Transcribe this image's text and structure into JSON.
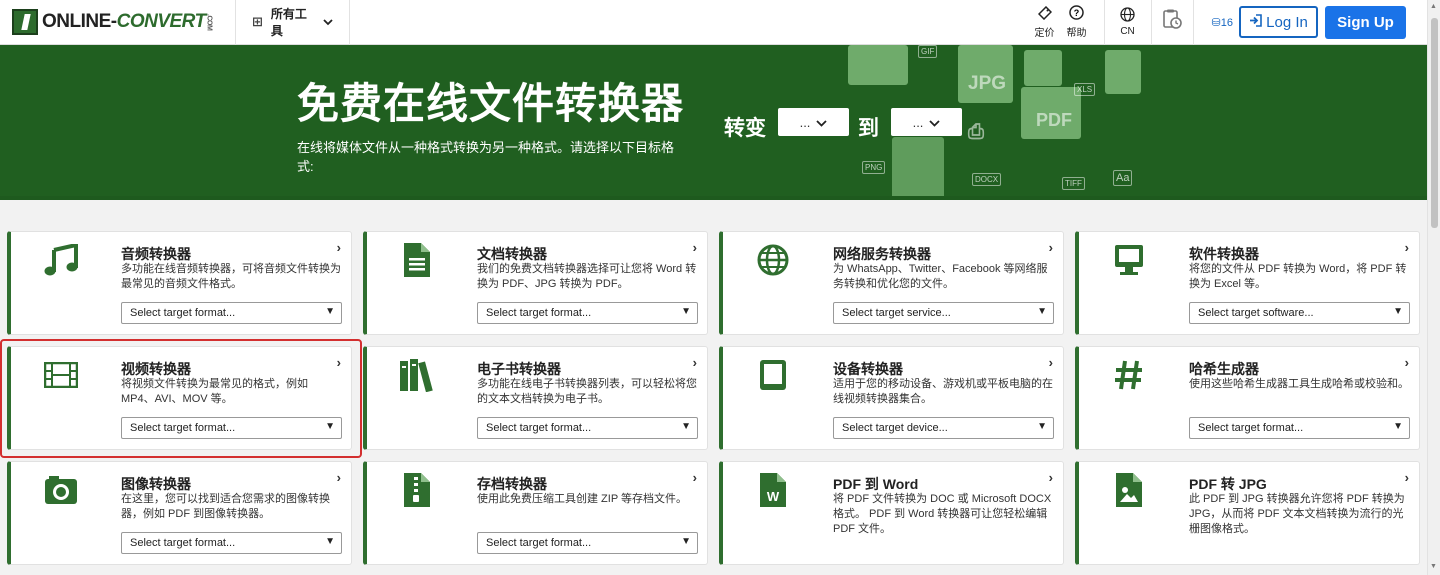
{
  "header": {
    "logo_main": "ONLINE-",
    "logo_conv": "CONVERT",
    "logo_com": ".COM",
    "all_tools": "所有工具",
    "pricing": "定价",
    "help": "帮助",
    "lang": "CN",
    "credits": "⛁16",
    "login": "Log In",
    "signup": "Sign Up"
  },
  "hero": {
    "title": "免费在线文件转换器",
    "subtitle": "在线将媒体文件从一种格式转换为另一种格式。请选择以下目标格式:",
    "convert_label": "转变",
    "to_label": "到",
    "from_select": "...",
    "to_select": "...",
    "deco_tags": [
      "GIF",
      "JPG",
      "XLS",
      "PDF",
      "PNG",
      "DOCX",
      "TIFF",
      "Aa"
    ]
  },
  "cards": [
    {
      "title": "音频转换器",
      "desc": "多功能在线音频转换器，可将音频文件转换为最常见的音频文件格式。",
      "select": "Select target format..."
    },
    {
      "title": "文档转换器",
      "desc": "我们的免费文档转换器选择可让您将 Word 转换为 PDF、JPG 转换为 PDF。",
      "select": "Select target format..."
    },
    {
      "title": "网络服务转换器",
      "desc": "为 WhatsApp、Twitter、Facebook 等网络服务转换和优化您的文件。",
      "select": "Select target service..."
    },
    {
      "title": "软件转换器",
      "desc": "将您的文件从 PDF 转换为 Word，将 PDF 转换为 Excel 等。",
      "select": "Select target software..."
    },
    {
      "title": "视频转换器",
      "desc": "将视频文件转换为最常见的格式，例如 MP4、AVI、MOV 等。",
      "select": "Select target format..."
    },
    {
      "title": "电子书转换器",
      "desc": "多功能在线电子书转换器列表，可以轻松将您的文本文档转换为电子书。",
      "select": "Select target format..."
    },
    {
      "title": "设备转换器",
      "desc": "适用于您的移动设备、游戏机或平板电脑的在线视频转换器集合。",
      "select": "Select target device..."
    },
    {
      "title": "哈希生成器",
      "desc": "使用这些哈希生成器工具生成哈希或校验和。",
      "select": "Select target format..."
    },
    {
      "title": "图像转换器",
      "desc": "在这里，您可以找到适合您需求的图像转换器，例如 PDF 到图像转换器。",
      "select": "Select target format..."
    },
    {
      "title": "存档转换器",
      "desc": "使用此免费压缩工具创建 ZIP 等存档文件。",
      "select": "Select target format..."
    },
    {
      "title": "PDF 到 Word",
      "desc": "将 PDF 文件转换为 DOC 或 Microsoft DOCX 格式。 PDF 到 Word 转换器可让您轻松编辑 PDF 文件。",
      "select": ""
    },
    {
      "title": "PDF 转 JPG",
      "desc": "此 PDF 到 JPG 转换器允许您将 PDF 转换为 JPG，从而将 PDF 文本文档转换为流行的光栅图像格式。",
      "select": ""
    }
  ],
  "colors": {
    "brand_green": "#205f20",
    "accent_blue": "#1a73e8",
    "highlight_red": "#d32f2f"
  }
}
